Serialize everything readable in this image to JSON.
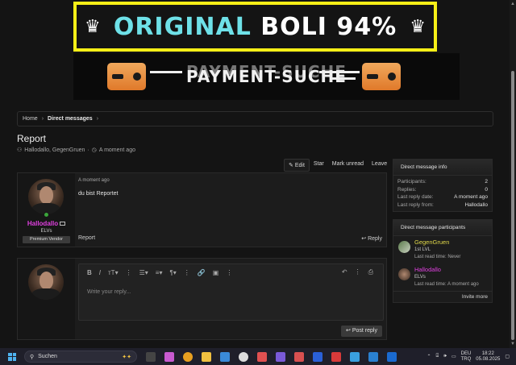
{
  "banners": {
    "top": {
      "word1": "ORIGINAL",
      "word2": "BOLI",
      "word3": "94%"
    },
    "second": {
      "text": "PAYMENT-SUCHE"
    }
  },
  "breadcrumb": {
    "home": "Home",
    "current": "Direct messages"
  },
  "conversation": {
    "title": "Report",
    "participants_line": "Hallodallo, GegenGruen",
    "time_line": "A moment ago"
  },
  "actions": {
    "edit": "Edit",
    "star": "Star",
    "mark_unread": "Mark unread",
    "leave": "Leave"
  },
  "message": {
    "author": "Hallodallo",
    "author_title": "ELVs",
    "author_badge": "Premium Vendor",
    "time": "A moment ago",
    "body": "du bist Reportet",
    "report": "Report",
    "reply": "Reply"
  },
  "reply_editor": {
    "placeholder": "Write your reply...",
    "post_button": "Post reply"
  },
  "info_panel": {
    "title": "Direct message info",
    "rows": [
      {
        "label": "Participants:",
        "value": "2"
      },
      {
        "label": "Replies:",
        "value": "0"
      },
      {
        "label": "Last reply date:",
        "value": "A moment ago"
      },
      {
        "label": "Last reply from:",
        "value": "Hallodallo"
      }
    ]
  },
  "participants_panel": {
    "title": "Direct message participants",
    "participants": [
      {
        "name": "GegenGruen",
        "title": "1st LVL",
        "last_read": "Last read time: Never",
        "color": "#e0d84a"
      },
      {
        "name": "Hallodallo",
        "title": "ELVs",
        "last_read": "Last read time: A moment ago",
        "color": "#e040e0"
      }
    ],
    "invite": "Invite more"
  },
  "taskbar": {
    "search_label": "Suchen",
    "lang_top": "DEU",
    "lang_bottom": "TRQ",
    "time": "18:22",
    "date": "05.08.2025"
  },
  "colors": {
    "accent_name": "#e040e0",
    "banner_yellow": "#f7ef17",
    "banner_cyan": "#6ee1e8"
  }
}
